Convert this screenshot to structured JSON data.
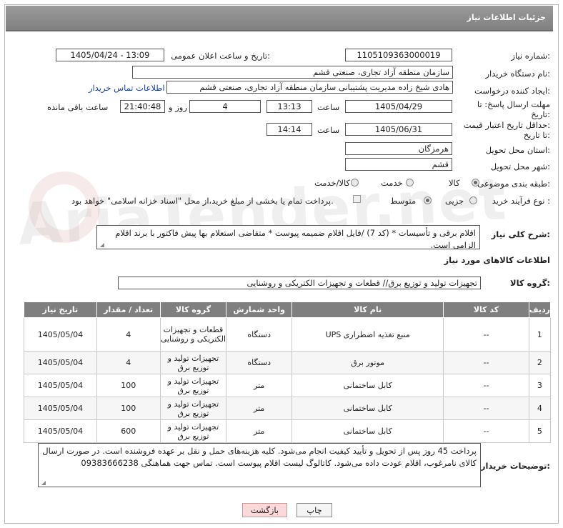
{
  "header": {
    "title": "جزئیات اطلاعات نیاز"
  },
  "form": {
    "need_number_label": "شماره نیاز:",
    "need_number": "1105109363000019",
    "announce_label": "تاریخ و ساعت اعلان عمومی:",
    "announce_value": "1405/04/24 - 13:09",
    "buyer_org_label": "نام دستگاه خریدار:",
    "buyer_org": "سازمان منطقه آزاد تجاری، صنعتی قشم",
    "requester_label": "ایجاد کننده درخواست:",
    "requester": "هادی شیخ زاده  مدیریت پشتیبانی سازمان منطقه آزاد تجاری، صنعتی قشم",
    "buyer_contact_link": "اطلاعات تماس خریدار",
    "deadline_label": "مهلت ارسال پاسخ: تا",
    "deadline_label2": "تاریخ:",
    "deadline_date": "1405/04/29",
    "time_label": "ساعت",
    "deadline_time": "13:13",
    "days_value": "4",
    "days_label": "روز و",
    "remaining_value": "21:40:48",
    "remaining_label": "ساعت باقی مانده",
    "validity_label": "حداقل تاریخ اعتبار قیمت:",
    "validity_label2": "تا تاریخ:",
    "validity_date": "1405/06/31",
    "validity_time": "14:14",
    "province_label": "استان محل تحویل:",
    "province": "هرمزگان",
    "city_label": "شهر محل تحویل:",
    "city": "قشم",
    "category_label": "طبقه بندی موضوعی:",
    "category_options": [
      "کالا",
      "خدمت",
      "کالا/خدمت"
    ],
    "process_label": "نوع فرآیند خرید :",
    "process_options": [
      "جزیی",
      "متوسط"
    ],
    "payment_note": "پرداخت تمام یا بخشی از مبلغ خرید،از محل \"اسناد خزانه اسلامی\" خواهد بود.",
    "description_label": "شرح کلی نیاز:",
    "description": "اقلام برقی و تأسیسات * (کد 7) /فایل اقلام ضمیمه پیوست * متقاضی استعلام بها پیش فاکتور با برند اقلام الزامی است.",
    "items_info_label": "اطلاعات کالاهای مورد نیاز",
    "goods_group_label": "گروه کالا:",
    "goods_group": "تجهیزات تولید و توزیع برق// قطعات و تجهیزات الکتریکی و روشنایی"
  },
  "table": {
    "headers": [
      "ردیف",
      "کد کالا",
      "نام کالا",
      "واحد شمارش",
      "گروه کالا",
      "تعداد / مقدار",
      "تاریخ نیاز"
    ],
    "rows": [
      [
        "1",
        "--",
        "منبع تغذیه اضطراری UPS",
        "دستگاه",
        "قطعات و تجهیزات الکتریکی و روشنایی",
        "4",
        "1405/05/04"
      ],
      [
        "2",
        "--",
        "موتور برق",
        "دستگاه",
        "تجهیزات تولید و توزیع برق",
        "4",
        "1405/05/04"
      ],
      [
        "3",
        "--",
        "کابل ساختمانی",
        "متر",
        "تجهیزات تولید و توزیع برق",
        "100",
        "1405/05/04"
      ],
      [
        "4",
        "--",
        "کابل ساختمانی",
        "متر",
        "تجهیزات تولید و توزیع برق",
        "100",
        "1405/05/04"
      ],
      [
        "5",
        "--",
        "کابل ساختمانی",
        "متر",
        "تجهیزات تولید و توزیع برق",
        "600",
        "1405/05/04"
      ]
    ]
  },
  "buyer_notes_label": "توضیحات خریدار:",
  "buyer_notes": "پرداخت 45 روز پس از تحویل و تأیید کیفیت انجام می‌شود. کلیه هزینه‌های حمل و نقل  بر عهده فروشنده است. در صورت ارسال کالای نامرغوب، اقلام عودت داده می‌شود. کاتالوگ لیست اقلام  پیوست است. تماس جهت هماهنگی 09383666238",
  "buttons": {
    "print": "چاپ",
    "back": "بازگشت"
  },
  "watermark": "AriaTender.net"
}
